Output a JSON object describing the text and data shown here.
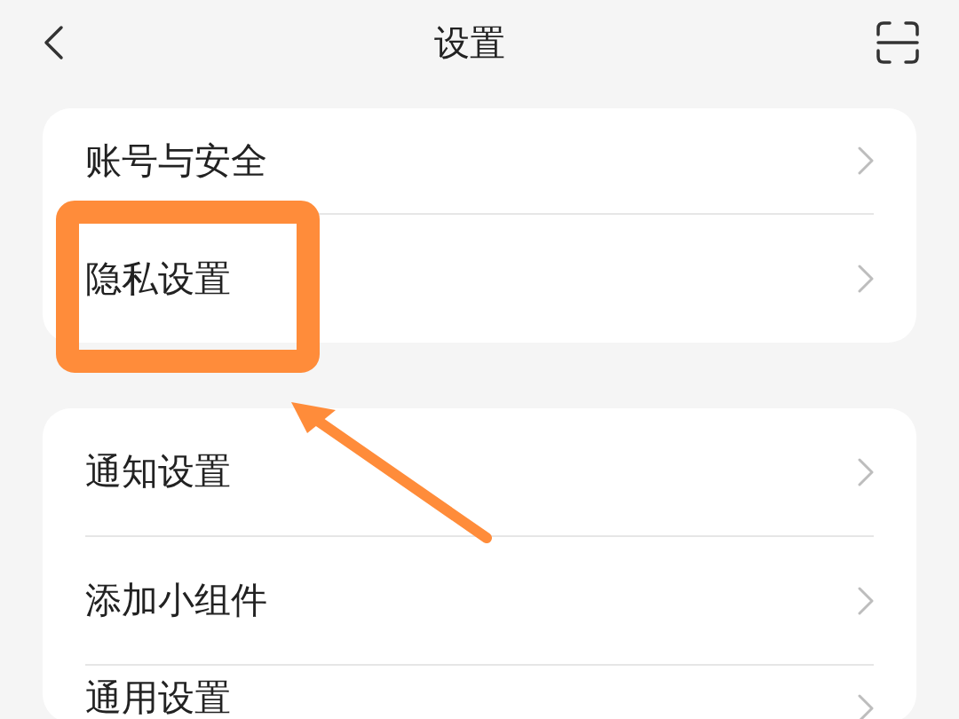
{
  "header": {
    "title": "设置"
  },
  "groups": [
    {
      "items": [
        {
          "label": "账号与安全"
        },
        {
          "label": "隐私设置"
        }
      ]
    },
    {
      "items": [
        {
          "label": "通知设置"
        },
        {
          "label": "添加小组件"
        },
        {
          "label": "通用设置"
        }
      ]
    }
  ]
}
